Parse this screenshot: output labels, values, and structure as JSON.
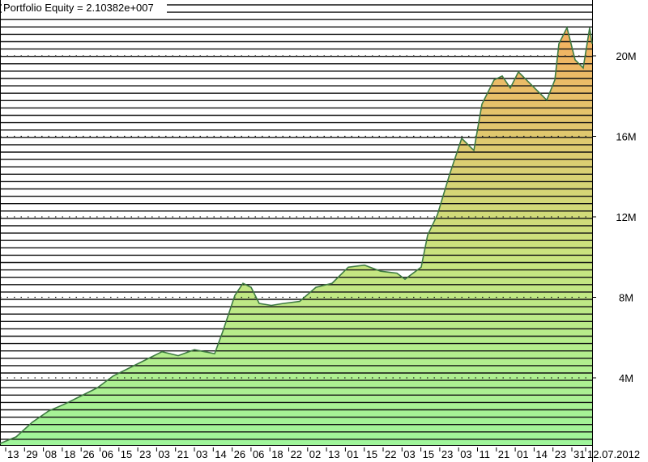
{
  "chart_data": {
    "type": "area",
    "title": "Portfolio Equity = 2.10382e+007",
    "xlabel": "",
    "ylabel": "",
    "ylim": [
      0,
      22000000
    ],
    "grid": "dotted horizontal at y ticks",
    "y_ticks": [
      4000000,
      8000000,
      12000000,
      16000000,
      20000000
    ],
    "y_tick_labels": [
      "4M",
      "8M",
      "12M",
      "16M",
      "20M"
    ],
    "x_tick_labels": [
      "13",
      "29",
      "08",
      "18",
      "26",
      "06",
      "15",
      "23",
      "03",
      "21",
      "03",
      "14",
      "26",
      "06",
      "18",
      "22",
      "02",
      "13",
      "01",
      "15",
      "22",
      "03",
      "15",
      "23",
      "03",
      "11",
      "21",
      "01",
      "14",
      "23",
      "31",
      "12.07.2012"
    ],
    "series": [
      {
        "name": "Portfolio Equity",
        "values": [
          0.74,
          1.07,
          1.8,
          2.35,
          2.7,
          3.1,
          3.5,
          4.1,
          4.5,
          4.9,
          5.3,
          5.1,
          5.4,
          5.2,
          6.3,
          8.1,
          8.7,
          8.5,
          7.7,
          7.6,
          7.7,
          7.8,
          8.5,
          8.7,
          9.5,
          9.6,
          9.3,
          9.2,
          8.9,
          9.5,
          11.1,
          12.1,
          14.1,
          15.9,
          15.3,
          17.6,
          18.8,
          19.0,
          18.4,
          19.2,
          18.8,
          18.4,
          17.8,
          18.8,
          20.6,
          21.4,
          19.8,
          19.4,
          21.4,
          20.6
        ],
        "x": [
          0,
          20,
          40,
          60,
          80,
          100,
          120,
          140,
          160,
          180,
          200,
          220,
          240,
          265,
          275,
          290,
          300,
          310,
          320,
          335,
          350,
          370,
          390,
          410,
          430,
          450,
          470,
          490,
          500,
          520,
          528,
          540,
          555,
          570,
          585,
          595,
          610,
          620,
          630,
          640,
          650,
          660,
          675,
          685,
          690,
          700,
          710,
          720,
          728,
          731
        ],
        "unit": "millions"
      }
    ],
    "colors": {
      "fill_bottom": "#9ff59a",
      "fill_top": "#f5b060",
      "line": "#3e7a42",
      "hlines": "#111111"
    }
  }
}
